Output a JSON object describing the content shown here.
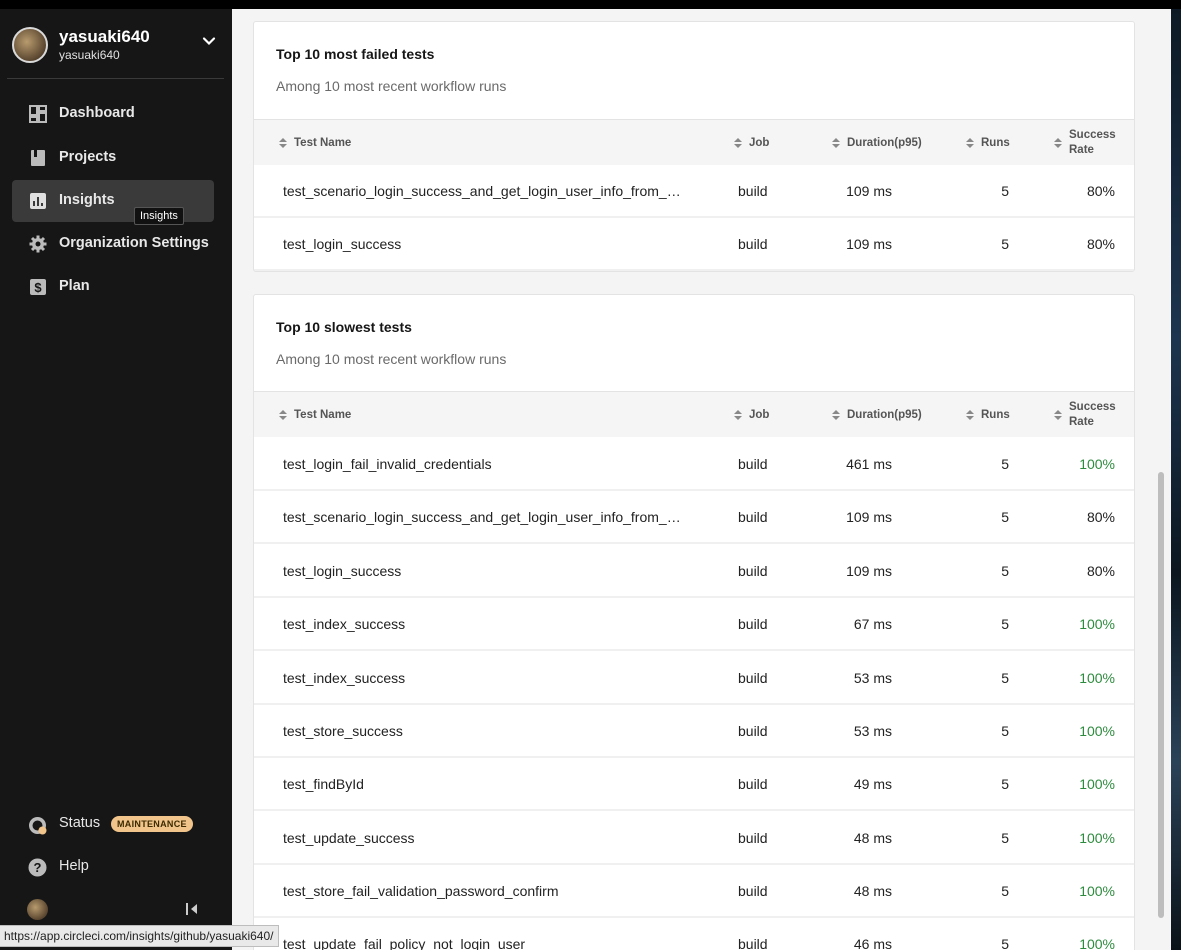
{
  "org": {
    "name": "yasuaki640",
    "sub": "yasuaki640"
  },
  "nav": [
    {
      "label": "Dashboard",
      "icon": "dashboard-icon"
    },
    {
      "label": "Projects",
      "icon": "book-icon"
    },
    {
      "label": "Insights",
      "icon": "chart-icon",
      "active": true
    },
    {
      "label": "Organization Settings",
      "icon": "gear-icon"
    },
    {
      "label": "Plan",
      "icon": "dollar-icon"
    }
  ],
  "tooltip": "Insights",
  "bottom": {
    "status_label": "Status",
    "status_badge": "MAINTENANCE",
    "help_label": "Help"
  },
  "status_url": "https://app.circleci.com/insights/github/yasuaki640/",
  "colors": {
    "accent_green": "#2e8b3e",
    "badge_bg": "#f0c48a"
  },
  "columns": {
    "name": "Test Name",
    "job": "Job",
    "duration": "Duration(p95)",
    "runs": "Runs",
    "rate_line1": "Success",
    "rate_line2": "Rate"
  },
  "failed": {
    "title": "Top 10 most failed tests",
    "subtitle": "Among 10 most recent workflow runs",
    "rows": [
      {
        "name": "test_scenario_login_success_and_get_login_user_info_from_…",
        "job": "build",
        "duration": "109 ms",
        "runs": "5",
        "rate": "80%"
      },
      {
        "name": "test_login_success",
        "job": "build",
        "duration": "109 ms",
        "runs": "5",
        "rate": "80%"
      }
    ]
  },
  "slowest": {
    "title": "Top 10 slowest tests",
    "subtitle": "Among 10 most recent workflow runs",
    "rows": [
      {
        "name": "test_login_fail_invalid_credentials",
        "job": "build",
        "duration": "461 ms",
        "runs": "5",
        "rate": "100%"
      },
      {
        "name": "test_scenario_login_success_and_get_login_user_info_from_…",
        "job": "build",
        "duration": "109 ms",
        "runs": "5",
        "rate": "80%"
      },
      {
        "name": "test_login_success",
        "job": "build",
        "duration": "109 ms",
        "runs": "5",
        "rate": "80%"
      },
      {
        "name": "test_index_success",
        "job": "build",
        "duration": "67 ms",
        "runs": "5",
        "rate": "100%"
      },
      {
        "name": "test_index_success",
        "job": "build",
        "duration": "53 ms",
        "runs": "5",
        "rate": "100%"
      },
      {
        "name": "test_store_success",
        "job": "build",
        "duration": "53 ms",
        "runs": "5",
        "rate": "100%"
      },
      {
        "name": "test_findById",
        "job": "build",
        "duration": "49 ms",
        "runs": "5",
        "rate": "100%"
      },
      {
        "name": "test_update_success",
        "job": "build",
        "duration": "48 ms",
        "runs": "5",
        "rate": "100%"
      },
      {
        "name": "test_store_fail_validation_password_confirm",
        "job": "build",
        "duration": "48 ms",
        "runs": "5",
        "rate": "100%"
      },
      {
        "name": "test_update_fail_policy_not_login_user",
        "job": "build",
        "duration": "46 ms",
        "runs": "5",
        "rate": "100%"
      }
    ]
  }
}
